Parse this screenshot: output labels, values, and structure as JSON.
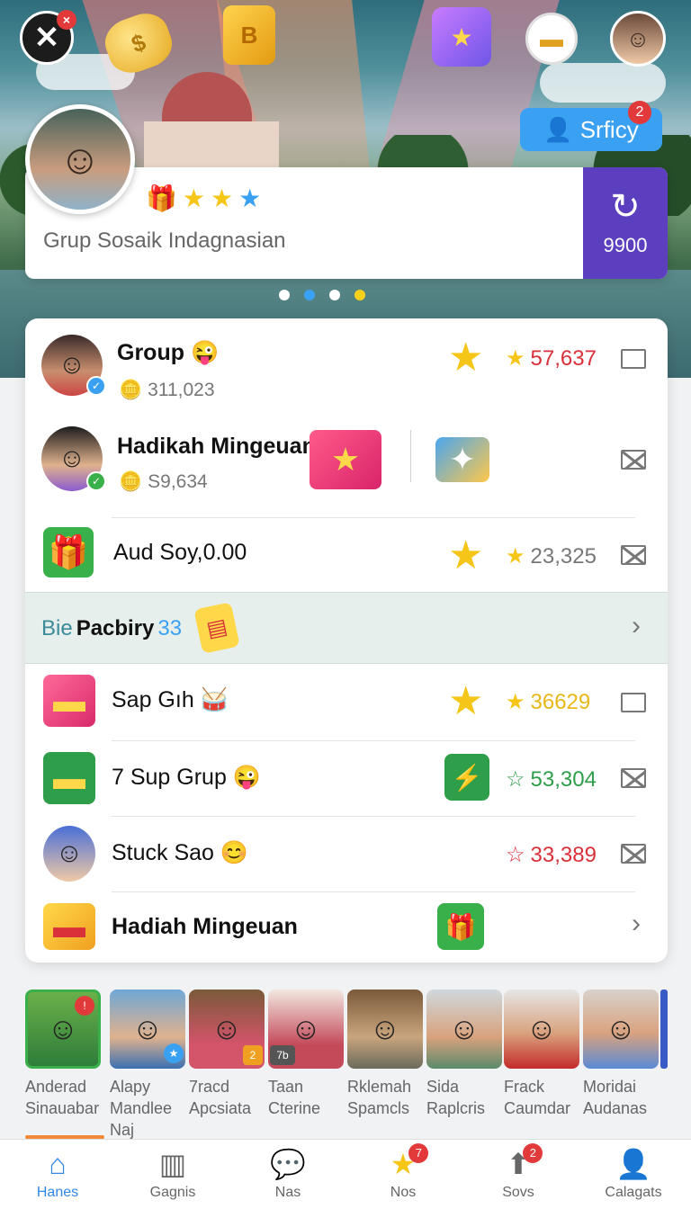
{
  "hero": {
    "close_badge": "×",
    "follow_label": "Srficy",
    "follow_badge": "2",
    "group_name": "Grup Sosaik Indagnasian",
    "side_score": "9900",
    "icons": [
      "close-icon",
      "coin-icon",
      "book-icon",
      "gift-icon",
      "chest-icon",
      "user-avatar"
    ],
    "dot_colors": [
      "#ffffff",
      "#3aa1f2",
      "#ffffff",
      "#f4d21c"
    ]
  },
  "list": {
    "rows": [
      {
        "title": "Group",
        "title_emoji": "😜",
        "sub": "311,023",
        "value": "57,637",
        "value_color": "#d9303a",
        "end": "box"
      },
      {
        "title": "Hadikah Mingeuan",
        "sub": "S9,634",
        "end": "mail"
      },
      {
        "title": "Aud Soy,0.00",
        "value": "23,325",
        "value_color": "#777777",
        "end": "mail"
      },
      {
        "banner_prefix": "Bie",
        "banner_bold": "Pacbiry",
        "banner_suffix": "33",
        "end": "chevron"
      },
      {
        "title": "Sap Gıh",
        "value": "36629",
        "value_color": "#e8b718",
        "end": "box"
      },
      {
        "title": "7 Sup Grup",
        "value": "53,304",
        "value_color": "#2e9e4a",
        "end": "mail"
      },
      {
        "title": "Stuck Sao",
        "value": "33,389",
        "value_color": "#d9303a",
        "end": "mail"
      },
      {
        "title": "Hadiah Mingeuan",
        "end": "chevron"
      }
    ]
  },
  "friends": [
    {
      "name": "Anderad\nSinauabar"
    },
    {
      "name": "Alapy\nMandlee\nNaj"
    },
    {
      "name": "7racd\nApcsiata",
      "badge": "2"
    },
    {
      "name": "Taan\nCterine",
      "tag": "7b"
    },
    {
      "name": "Rklemah\nSpamcls"
    },
    {
      "name": "Sida\nRaplcris"
    },
    {
      "name": "Frack\nCaumdar"
    },
    {
      "name": "Moridai\nAudanas"
    }
  ],
  "nav": [
    {
      "label": "Hanes",
      "icon": "home-icon",
      "active": true
    },
    {
      "label": "Gagnis",
      "icon": "chart-icon"
    },
    {
      "label": "Nas",
      "icon": "chat-icon"
    },
    {
      "label": "Nos",
      "icon": "star-icon",
      "badge": "7"
    },
    {
      "label": "Sovs",
      "icon": "rocket-icon",
      "badge": "2"
    },
    {
      "label": "Calagats",
      "icon": "profile-icon"
    }
  ]
}
